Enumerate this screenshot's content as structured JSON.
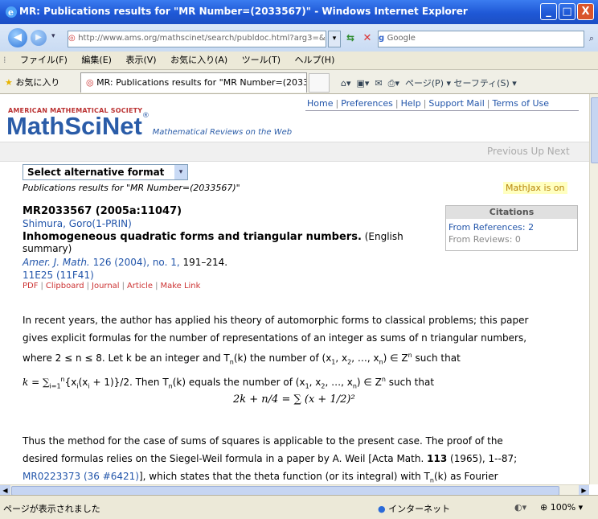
{
  "window": {
    "title": "MR: Publications results for \"MR Number=(2033567)\" - Windows Internet Explorer",
    "min": "_",
    "max": "□",
    "close": "X"
  },
  "address": {
    "url": "http://www.ams.org/mathscinet/search/publdoc.html?arg3=&co",
    "search_placeholder": "Google"
  },
  "menu": [
    "ファイル(F)",
    "編集(E)",
    "表示(V)",
    "お気に入り(A)",
    "ツール(T)",
    "ヘルプ(H)"
  ],
  "favorites": {
    "label": "お気に入り",
    "tab_title": "MR: Publications results for \"MR Number=(203356...",
    "tools": "ページ(P) ▾   セーフティ(S) ▾"
  },
  "header": {
    "ams": "AMERICAN MATHEMATICAL SOCIETY",
    "logo": "MathSciNet",
    "logo_reg": "®",
    "tagline": "Mathematical Reviews on the Web",
    "links": [
      "Home",
      "Preferences",
      "Help",
      "Support Mail",
      "Terms of Use"
    ]
  },
  "pager": {
    "prev": "Previous",
    "up": "Up",
    "next": "Next"
  },
  "format": {
    "select": "Select alternative format"
  },
  "results": {
    "caption": "Publications results for \"MR Number=(2033567)\"",
    "mathjax": "MathJax is on"
  },
  "record": {
    "id": "MR2033567 (2005a:11047)",
    "author": "Shimura, Goro",
    "affil": "(1-PRIN)",
    "title": "Inhomogeneous quadratic forms and triangular numbers.",
    "lang": "(English summary)",
    "journal": "Amer. J. Math.",
    "volume": "126 (2004), no. 1,",
    "pages": "191–214.",
    "class1": "11E25",
    "class2": "(11F41)",
    "actions": [
      "PDF",
      "Clipboard",
      "Journal",
      "Article",
      "Make Link"
    ]
  },
  "citations": {
    "header": "Citations",
    "refs": "From References: 2",
    "reviews": "From Reviews: 0"
  },
  "review": {
    "p1a": "In recent years, the author has applied his theory of automorphic forms to classical problems; this paper",
    "p1b": "gives explicit formulas for the number of representations of an integer as sums of n triangular numbers,",
    "p1c": "where 2 ≤ n ≤ 8. Let k be an integer and T",
    "p1c2": "(k) the number of (x",
    "p1c3": ") ∈ Z",
    "p1c4": " such that",
    "p1d": "k = ∑",
    "p1d2": "{x",
    "p1d3": "+ 1)}/2. Then T",
    "p1d4": "(k) equals the number of (x",
    "p1d5": ") ∈ Z",
    "p1d6": " such that",
    "equation": "2k + n/4 = ∑ (x + 1/2)²",
    "p2a": "Thus the method for the case of sums of squares is applicable to the present case. The proof of the",
    "p2b": "desired formulas relies on the Siegel-Weil formula in a paper by A. Weil [Acta Math.",
    "p2b_bold": "113",
    "p2b_end": "(1965), 1--87;",
    "p2c_link": "MR0223373 (36 #6421)",
    "p2c": "], which states that the theta function (or its integral) with T",
    "p2c_end": "(k) as Fourier"
  },
  "status": {
    "text": "ページが表示されました",
    "zone": "インターネット",
    "zoom": "100%"
  }
}
